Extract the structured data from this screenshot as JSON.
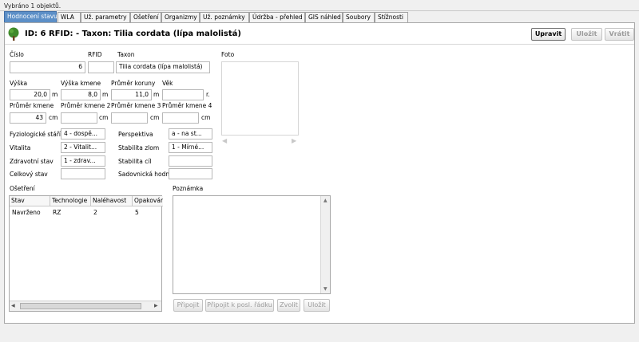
{
  "status": "Vybráno 1 objektů.",
  "tabs": [
    "Hodnocení stavu",
    "WLA",
    "Už. parametry",
    "Ošetření",
    "Organizmy",
    "Už. poznámky",
    "Údržba - přehled",
    "GIS náhled",
    "Soubory",
    "Stížnosti"
  ],
  "header": {
    "title": "ID:  6  RFID:  -   Taxon:  Tilia cordata (lípa malolistá)",
    "btn_edit": "Upravit",
    "btn_save": "Uložit",
    "btn_revert": "Vrátit"
  },
  "form": {
    "cislo_label": "Číslo",
    "cislo": "6",
    "rfid_label": "RFID",
    "rfid": "",
    "taxon_label": "Taxon",
    "taxon": "Tilia cordata (lípa malolistá)",
    "vyska_label": "Výška",
    "vyska": "20,0",
    "vyska_kmene_label": "Výška kmene",
    "vyska_kmene": "8,0",
    "prumer_koruny_label": "Průměr koruny",
    "prumer_koruny": "11,0",
    "vek_label": "Věk",
    "vek": "",
    "unit_m": "m",
    "unit_cm": "cm",
    "unit_r": "r.",
    "prumer_kmene_label": "Průměr kmene",
    "prumer_kmene": "43",
    "prumer_kmene2_label": "Průměr kmene 2",
    "prumer_kmene2": "",
    "prumer_kmene3_label": "Průměr kmene 3",
    "prumer_kmene3": "",
    "prumer_kmene4_label": "Průměr kmene 4",
    "prumer_kmene4": "",
    "fyz_stari_label": "Fyziologické stáří",
    "fyz_stari": "4 - dospě...",
    "perspektiva_label": "Perspektiva",
    "perspektiva": "a - na st...",
    "vitalita_label": "Vitalita",
    "vitalita": "2 - Vitalit...",
    "stab_zlom_label": "Stabilita zlom",
    "stab_zlom": "1 - Mírné...",
    "zdrav_stav_label": "Zdravotní stav",
    "zdrav_stav": "1 - zdrav...",
    "stab_cil_label": "Stabilita cíl",
    "stab_cil": "",
    "celk_stav_label": "Celkový stav",
    "celk_stav": "",
    "sadov_hodnota_label": "Sadovnická hodnota",
    "sadov_hodnota": ""
  },
  "foto_label": "Foto",
  "osetreni": {
    "label": "Ošetření",
    "columns": [
      "Stav",
      "Technologie",
      "Naléhavost",
      "Opakovár"
    ],
    "rows": [
      [
        "Navrženo",
        "RZ",
        "2",
        "5"
      ]
    ]
  },
  "poznamka": {
    "label": "Poznámka",
    "btn_pripojit": "Připojit",
    "btn_pripojit_posl": "Připojit k posl. řádku",
    "btn_zvolit": "Zvolit",
    "btn_ulozit": "Uložit"
  }
}
